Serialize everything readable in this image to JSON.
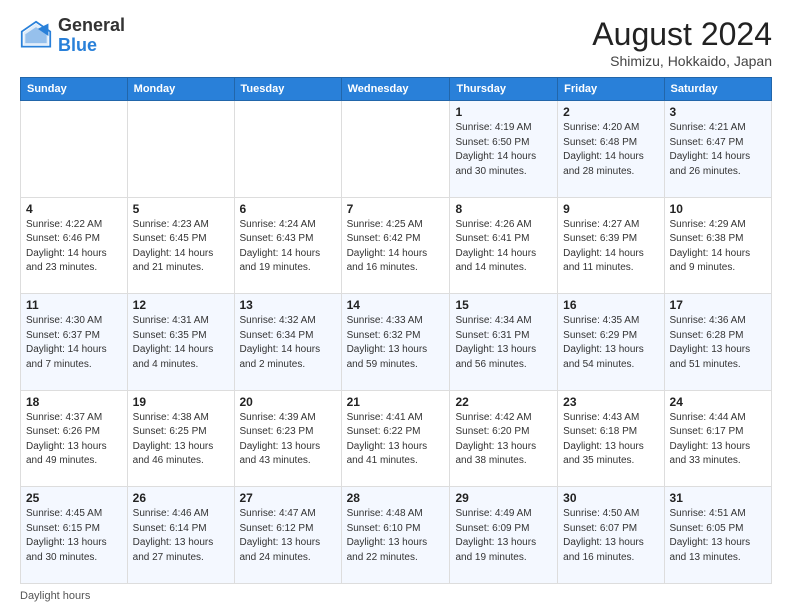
{
  "header": {
    "logo_line1": "General",
    "logo_line2": "Blue",
    "main_title": "August 2024",
    "subtitle": "Shimizu, Hokkaido, Japan"
  },
  "days_of_week": [
    "Sunday",
    "Monday",
    "Tuesday",
    "Wednesday",
    "Thursday",
    "Friday",
    "Saturday"
  ],
  "weeks": [
    [
      {
        "day": "",
        "info": ""
      },
      {
        "day": "",
        "info": ""
      },
      {
        "day": "",
        "info": ""
      },
      {
        "day": "",
        "info": ""
      },
      {
        "day": "1",
        "info": "Sunrise: 4:19 AM\nSunset: 6:50 PM\nDaylight: 14 hours\nand 30 minutes."
      },
      {
        "day": "2",
        "info": "Sunrise: 4:20 AM\nSunset: 6:48 PM\nDaylight: 14 hours\nand 28 minutes."
      },
      {
        "day": "3",
        "info": "Sunrise: 4:21 AM\nSunset: 6:47 PM\nDaylight: 14 hours\nand 26 minutes."
      }
    ],
    [
      {
        "day": "4",
        "info": "Sunrise: 4:22 AM\nSunset: 6:46 PM\nDaylight: 14 hours\nand 23 minutes."
      },
      {
        "day": "5",
        "info": "Sunrise: 4:23 AM\nSunset: 6:45 PM\nDaylight: 14 hours\nand 21 minutes."
      },
      {
        "day": "6",
        "info": "Sunrise: 4:24 AM\nSunset: 6:43 PM\nDaylight: 14 hours\nand 19 minutes."
      },
      {
        "day": "7",
        "info": "Sunrise: 4:25 AM\nSunset: 6:42 PM\nDaylight: 14 hours\nand 16 minutes."
      },
      {
        "day": "8",
        "info": "Sunrise: 4:26 AM\nSunset: 6:41 PM\nDaylight: 14 hours\nand 14 minutes."
      },
      {
        "day": "9",
        "info": "Sunrise: 4:27 AM\nSunset: 6:39 PM\nDaylight: 14 hours\nand 11 minutes."
      },
      {
        "day": "10",
        "info": "Sunrise: 4:29 AM\nSunset: 6:38 PM\nDaylight: 14 hours\nand 9 minutes."
      }
    ],
    [
      {
        "day": "11",
        "info": "Sunrise: 4:30 AM\nSunset: 6:37 PM\nDaylight: 14 hours\nand 7 minutes."
      },
      {
        "day": "12",
        "info": "Sunrise: 4:31 AM\nSunset: 6:35 PM\nDaylight: 14 hours\nand 4 minutes."
      },
      {
        "day": "13",
        "info": "Sunrise: 4:32 AM\nSunset: 6:34 PM\nDaylight: 14 hours\nand 2 minutes."
      },
      {
        "day": "14",
        "info": "Sunrise: 4:33 AM\nSunset: 6:32 PM\nDaylight: 13 hours\nand 59 minutes."
      },
      {
        "day": "15",
        "info": "Sunrise: 4:34 AM\nSunset: 6:31 PM\nDaylight: 13 hours\nand 56 minutes."
      },
      {
        "day": "16",
        "info": "Sunrise: 4:35 AM\nSunset: 6:29 PM\nDaylight: 13 hours\nand 54 minutes."
      },
      {
        "day": "17",
        "info": "Sunrise: 4:36 AM\nSunset: 6:28 PM\nDaylight: 13 hours\nand 51 minutes."
      }
    ],
    [
      {
        "day": "18",
        "info": "Sunrise: 4:37 AM\nSunset: 6:26 PM\nDaylight: 13 hours\nand 49 minutes."
      },
      {
        "day": "19",
        "info": "Sunrise: 4:38 AM\nSunset: 6:25 PM\nDaylight: 13 hours\nand 46 minutes."
      },
      {
        "day": "20",
        "info": "Sunrise: 4:39 AM\nSunset: 6:23 PM\nDaylight: 13 hours\nand 43 minutes."
      },
      {
        "day": "21",
        "info": "Sunrise: 4:41 AM\nSunset: 6:22 PM\nDaylight: 13 hours\nand 41 minutes."
      },
      {
        "day": "22",
        "info": "Sunrise: 4:42 AM\nSunset: 6:20 PM\nDaylight: 13 hours\nand 38 minutes."
      },
      {
        "day": "23",
        "info": "Sunrise: 4:43 AM\nSunset: 6:18 PM\nDaylight: 13 hours\nand 35 minutes."
      },
      {
        "day": "24",
        "info": "Sunrise: 4:44 AM\nSunset: 6:17 PM\nDaylight: 13 hours\nand 33 minutes."
      }
    ],
    [
      {
        "day": "25",
        "info": "Sunrise: 4:45 AM\nSunset: 6:15 PM\nDaylight: 13 hours\nand 30 minutes."
      },
      {
        "day": "26",
        "info": "Sunrise: 4:46 AM\nSunset: 6:14 PM\nDaylight: 13 hours\nand 27 minutes."
      },
      {
        "day": "27",
        "info": "Sunrise: 4:47 AM\nSunset: 6:12 PM\nDaylight: 13 hours\nand 24 minutes."
      },
      {
        "day": "28",
        "info": "Sunrise: 4:48 AM\nSunset: 6:10 PM\nDaylight: 13 hours\nand 22 minutes."
      },
      {
        "day": "29",
        "info": "Sunrise: 4:49 AM\nSunset: 6:09 PM\nDaylight: 13 hours\nand 19 minutes."
      },
      {
        "day": "30",
        "info": "Sunrise: 4:50 AM\nSunset: 6:07 PM\nDaylight: 13 hours\nand 16 minutes."
      },
      {
        "day": "31",
        "info": "Sunrise: 4:51 AM\nSunset: 6:05 PM\nDaylight: 13 hours\nand 13 minutes."
      }
    ]
  ],
  "footer": {
    "daylight_label": "Daylight hours"
  },
  "colors": {
    "header_bg": "#2980d9",
    "header_text": "#ffffff",
    "odd_row": "#f4f8ff",
    "even_row": "#ffffff"
  }
}
